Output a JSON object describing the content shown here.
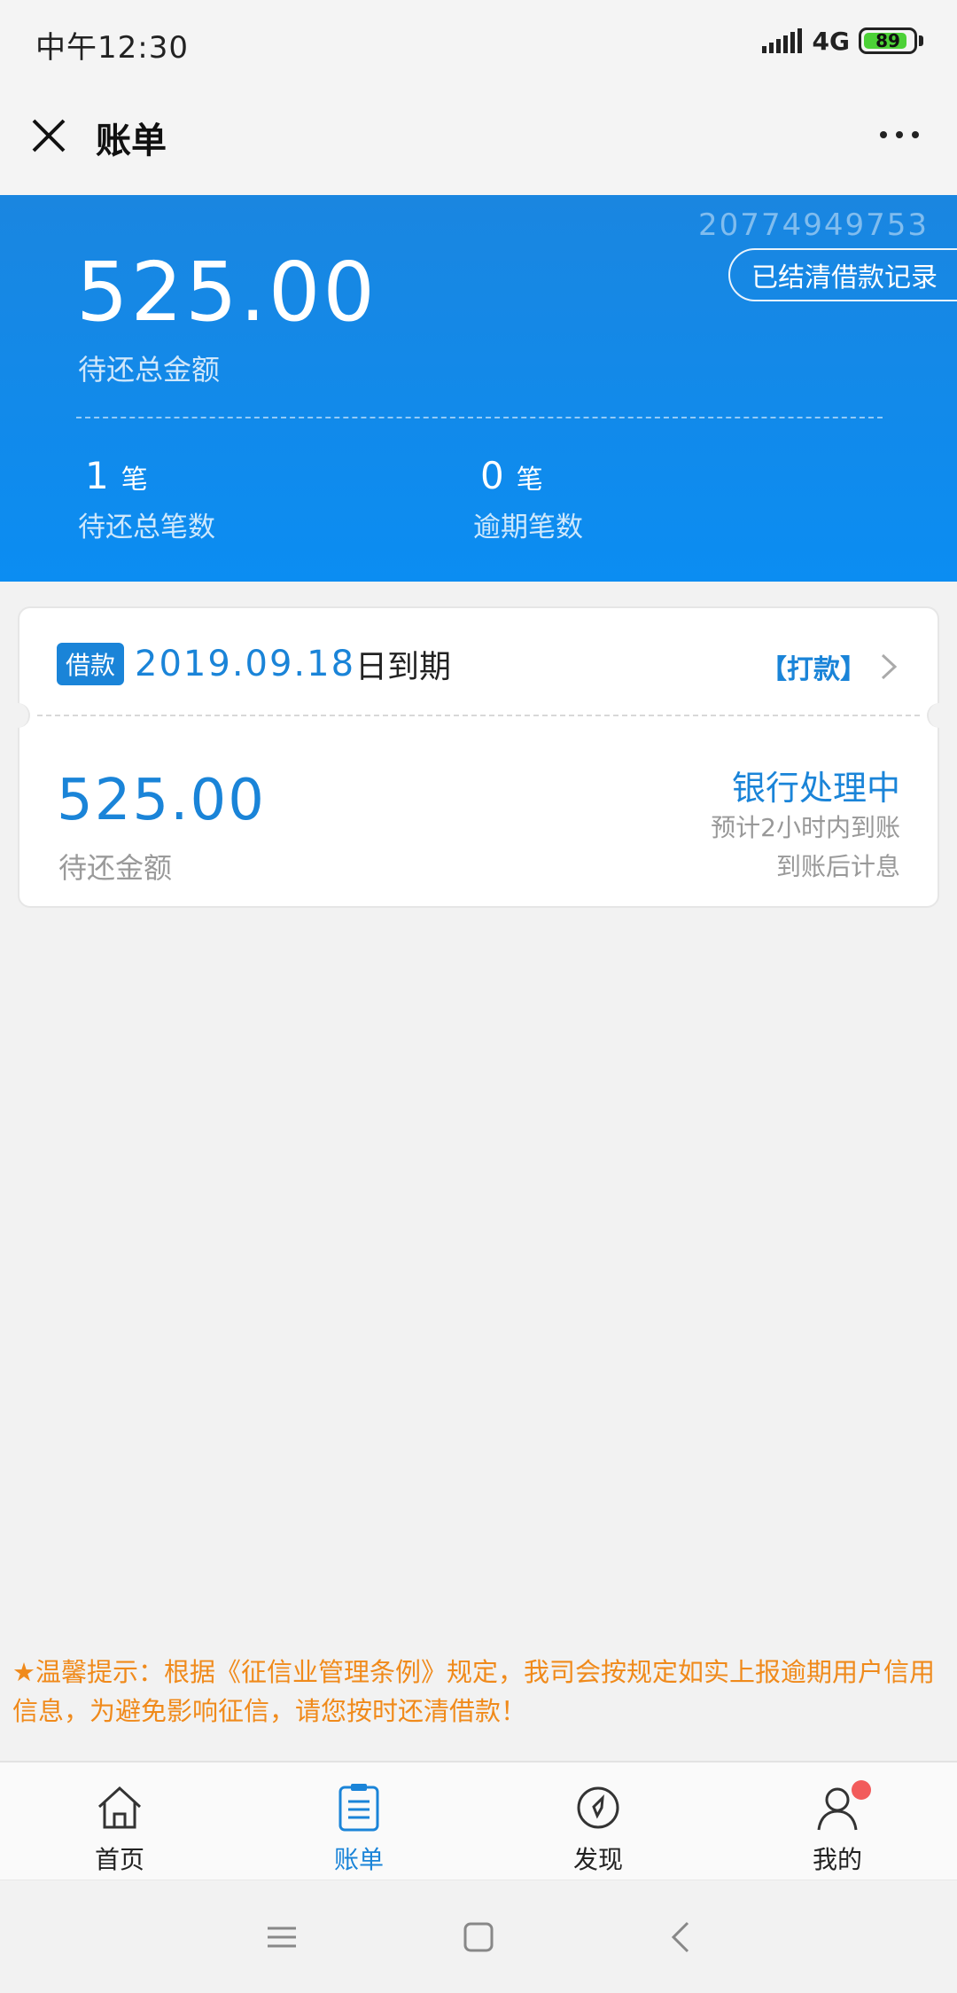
{
  "status_bar": {
    "time": "中午12:30",
    "network": "4G",
    "battery": "89",
    "battery_level": 0.89
  },
  "header": {
    "title": "账单"
  },
  "summary": {
    "order_no": "20774949753",
    "total_amount": "525.00",
    "total_label": "待还总金额",
    "settled_button": "已结清借款记录",
    "count_value": "1",
    "count_unit": "笔",
    "count_label": "待还总笔数",
    "overdue_value": "0",
    "overdue_unit": "笔",
    "overdue_label": "逾期笔数"
  },
  "bill": {
    "tag": "借款",
    "due_date": "2019.09.18",
    "due_suffix": "日到期",
    "action": "【打款】",
    "amount": "525.00",
    "amount_label": "待还金额",
    "status": "银行处理中",
    "note1": "预计2小时内到账",
    "note2": "到账后计息"
  },
  "tip": "★温馨提示：根据《征信业管理条例》规定，我司会按规定如实上报逾期用户信用信息，为避免影响征信，请您按时还清借款！",
  "tabs": [
    {
      "label": "首页",
      "icon": "home-icon"
    },
    {
      "label": "账单",
      "icon": "bill-icon"
    },
    {
      "label": "发现",
      "icon": "compass-icon"
    },
    {
      "label": "我的",
      "icon": "user-icon"
    }
  ],
  "colors": {
    "primary": "#1a84d8",
    "header_bg": "#0b8df2",
    "tip": "#f08a1b",
    "badge": "#f25b5b"
  }
}
